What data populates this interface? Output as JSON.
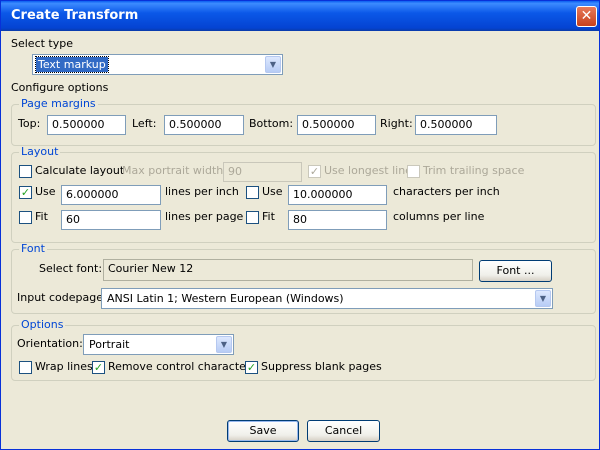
{
  "window": {
    "title": "Create Transform",
    "close_glyph": "✕"
  },
  "select_type": {
    "label": "Select type",
    "value": "Text markup"
  },
  "configure_label": "Configure options",
  "page_margins": {
    "legend": "Page margins",
    "top_label": "Top:",
    "top_value": "0.500000",
    "left_label": "Left:",
    "left_value": "0.500000",
    "bottom_label": "Bottom:",
    "bottom_value": "0.500000",
    "right_label": "Right:",
    "right_value": "0.500000"
  },
  "layout": {
    "legend": "Layout",
    "calculate_label": "Calculate layout",
    "calculate_checked": false,
    "max_portrait_label": "Max portrait width:",
    "max_portrait_value": "90",
    "use_longest_label": "Use longest line",
    "use_longest_checked": true,
    "trim_trailing_label": "Trim trailing space",
    "trim_trailing_checked": false,
    "use_lpi_label": "Use",
    "use_lpi_checked": true,
    "lpi_value": "6.000000",
    "lpi_unit": "lines per inch",
    "use_cpi_label": "Use",
    "use_cpi_checked": false,
    "cpi_value": "10.000000",
    "cpi_unit": "characters per inch",
    "fit_lpp_label": "Fit",
    "fit_lpp_checked": false,
    "lpp_value": "60",
    "lpp_unit": "lines per page",
    "fit_cpl_label": "Fit",
    "fit_cpl_checked": false,
    "cpl_value": "80",
    "cpl_unit": "columns per line"
  },
  "font": {
    "legend": "Font",
    "select_font_label": "Select font:",
    "font_value": "Courier New 12",
    "font_button": "Font ...",
    "codepage_label": "Input codepage:",
    "codepage_value": "ANSI Latin 1; Western European (Windows)"
  },
  "options": {
    "legend": "Options",
    "orientation_label": "Orientation:",
    "orientation_value": "Portrait",
    "wrap_label": "Wrap lines",
    "wrap_checked": false,
    "remove_control_label": "Remove control characters",
    "remove_control_checked": true,
    "suppress_blank_label": "Suppress blank pages",
    "suppress_blank_checked": true
  },
  "buttons": {
    "save": "Save",
    "cancel": "Cancel"
  },
  "icons": {
    "check_glyph": "✓",
    "dropdown_glyph": "▼"
  },
  "colors": {
    "titlebar": "#0a5ef0",
    "legend_text": "#0046d5",
    "dialog_bg": "#ece9d8",
    "check": "#21a121"
  }
}
